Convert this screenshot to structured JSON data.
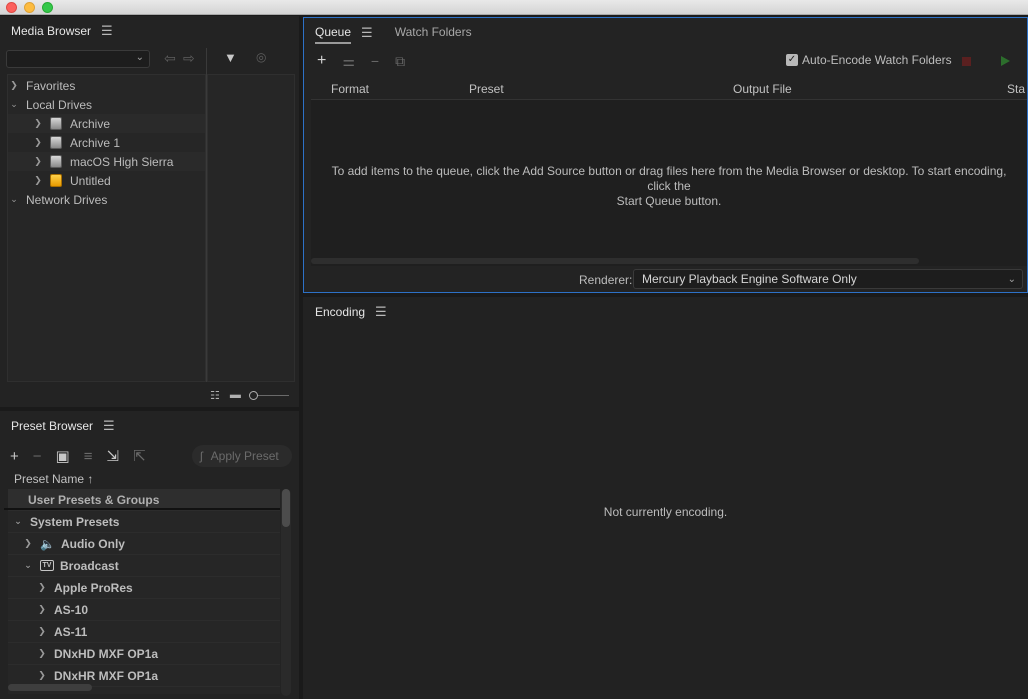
{
  "window": {
    "traffic_lights": [
      "close",
      "minimize",
      "maximize"
    ]
  },
  "media_browser": {
    "title": "Media Browser",
    "tree": {
      "favorites": "Favorites",
      "local_drives": "Local Drives",
      "drives": [
        {
          "label": "Archive",
          "icon": "hard-drive-icon"
        },
        {
          "label": "Archive 1",
          "icon": "hard-drive-icon"
        },
        {
          "label": "macOS High Sierra",
          "icon": "hard-drive-icon"
        },
        {
          "label": "Untitled",
          "icon": "usb-drive-icon"
        }
      ],
      "network_drives": "Network Drives"
    }
  },
  "preset_browser": {
    "title": "Preset Browser",
    "apply_preset": "Apply Preset",
    "column_header": "Preset Name",
    "rows": {
      "user_presets": "User Presets & Groups",
      "system_presets": "System Presets",
      "audio_only": "Audio Only",
      "broadcast": "Broadcast",
      "apple_prores": "Apple ProRes",
      "as10": "AS-10",
      "as11": "AS-11",
      "dnxhd": "DNxHD MXF OP1a",
      "dnxhr": "DNxHR MXF OP1a"
    },
    "tv_icon_text": "TV"
  },
  "queue": {
    "tabs": [
      "Queue",
      "Watch Folders"
    ],
    "auto_encode_label": "Auto-Encode Watch Folders",
    "auto_encode_checked": true,
    "columns": {
      "format": "Format",
      "preset": "Preset",
      "output_file": "Output File",
      "status": "Sta"
    },
    "empty_message_line1": "To add items to the queue, click the Add Source button or drag files here from the Media Browser or desktop.  To start encoding, click the",
    "empty_message_line2": "Start Queue button.",
    "renderer_label": "Renderer:",
    "renderer_value": "Mercury Playback Engine Software Only",
    "colors": {
      "stop": "#5a2020",
      "start": "#2c6e2c",
      "focus_border": "#2d71c7"
    }
  },
  "encoding": {
    "title": "Encoding",
    "status": "Not currently encoding."
  }
}
